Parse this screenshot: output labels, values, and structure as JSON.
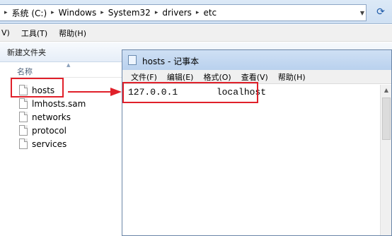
{
  "explorer": {
    "breadcrumbs": [
      "系统 (C:)",
      "Windows",
      "System32",
      "drivers",
      "etc"
    ],
    "menu": [
      "V)",
      "工具(T)",
      "帮助(H)"
    ],
    "toolbar": {
      "new_folder_label": "新建文件夹"
    },
    "list_header": {
      "name_label": "名称"
    },
    "files": [
      "hosts",
      "lmhosts.sam",
      "networks",
      "protocol",
      "services"
    ]
  },
  "notepad": {
    "title": "hosts - 记事本",
    "menu": [
      "文件(F)",
      "编辑(E)",
      "格式(O)",
      "查看(V)",
      "帮助(H)"
    ],
    "content_line": "127.0.0.1       localhost"
  },
  "colors": {
    "highlight": "#e0202a",
    "accent": "#1e5aa8"
  },
  "icons": [
    "refresh-icon",
    "file-icon",
    "notepad-icon",
    "arrow-icon"
  ]
}
